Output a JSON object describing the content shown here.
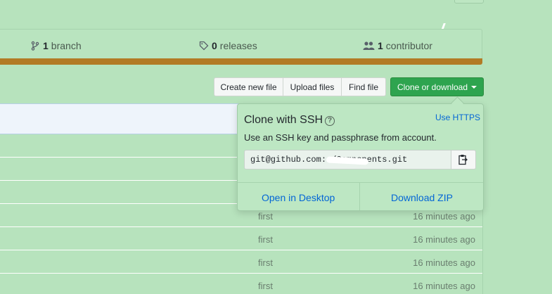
{
  "stats": {
    "branches": {
      "count": "1",
      "label": "branch"
    },
    "releases": {
      "count": "0",
      "label": "releases"
    },
    "contributors": {
      "count": "1",
      "label": "contributor"
    }
  },
  "language_bar_color": "#b27b25",
  "toolbar": {
    "create_new_file": "Create new file",
    "upload_files": "Upload files",
    "find_file": "Find file",
    "clone_or_download": "Clone or download"
  },
  "clone_popover": {
    "title": "Clone with SSH",
    "use_https": "Use HTTPS",
    "description": "Use an SSH key and passphrase from account.",
    "url": "git@github.com:          /Components.git",
    "open_in_desktop": "Open in Desktop",
    "download_zip": "Download ZIP"
  },
  "files": [
    {
      "message": "first",
      "age": "16 minutes ago"
    },
    {
      "message": "first",
      "age": "16 minutes ago"
    },
    {
      "message": "first",
      "age": "16 minutes ago"
    },
    {
      "message": "first",
      "age": "16 minutes ago"
    }
  ],
  "colors": {
    "background": "#b7e3bd",
    "clone_button": "#2ea44f",
    "link": "#0366d6"
  }
}
